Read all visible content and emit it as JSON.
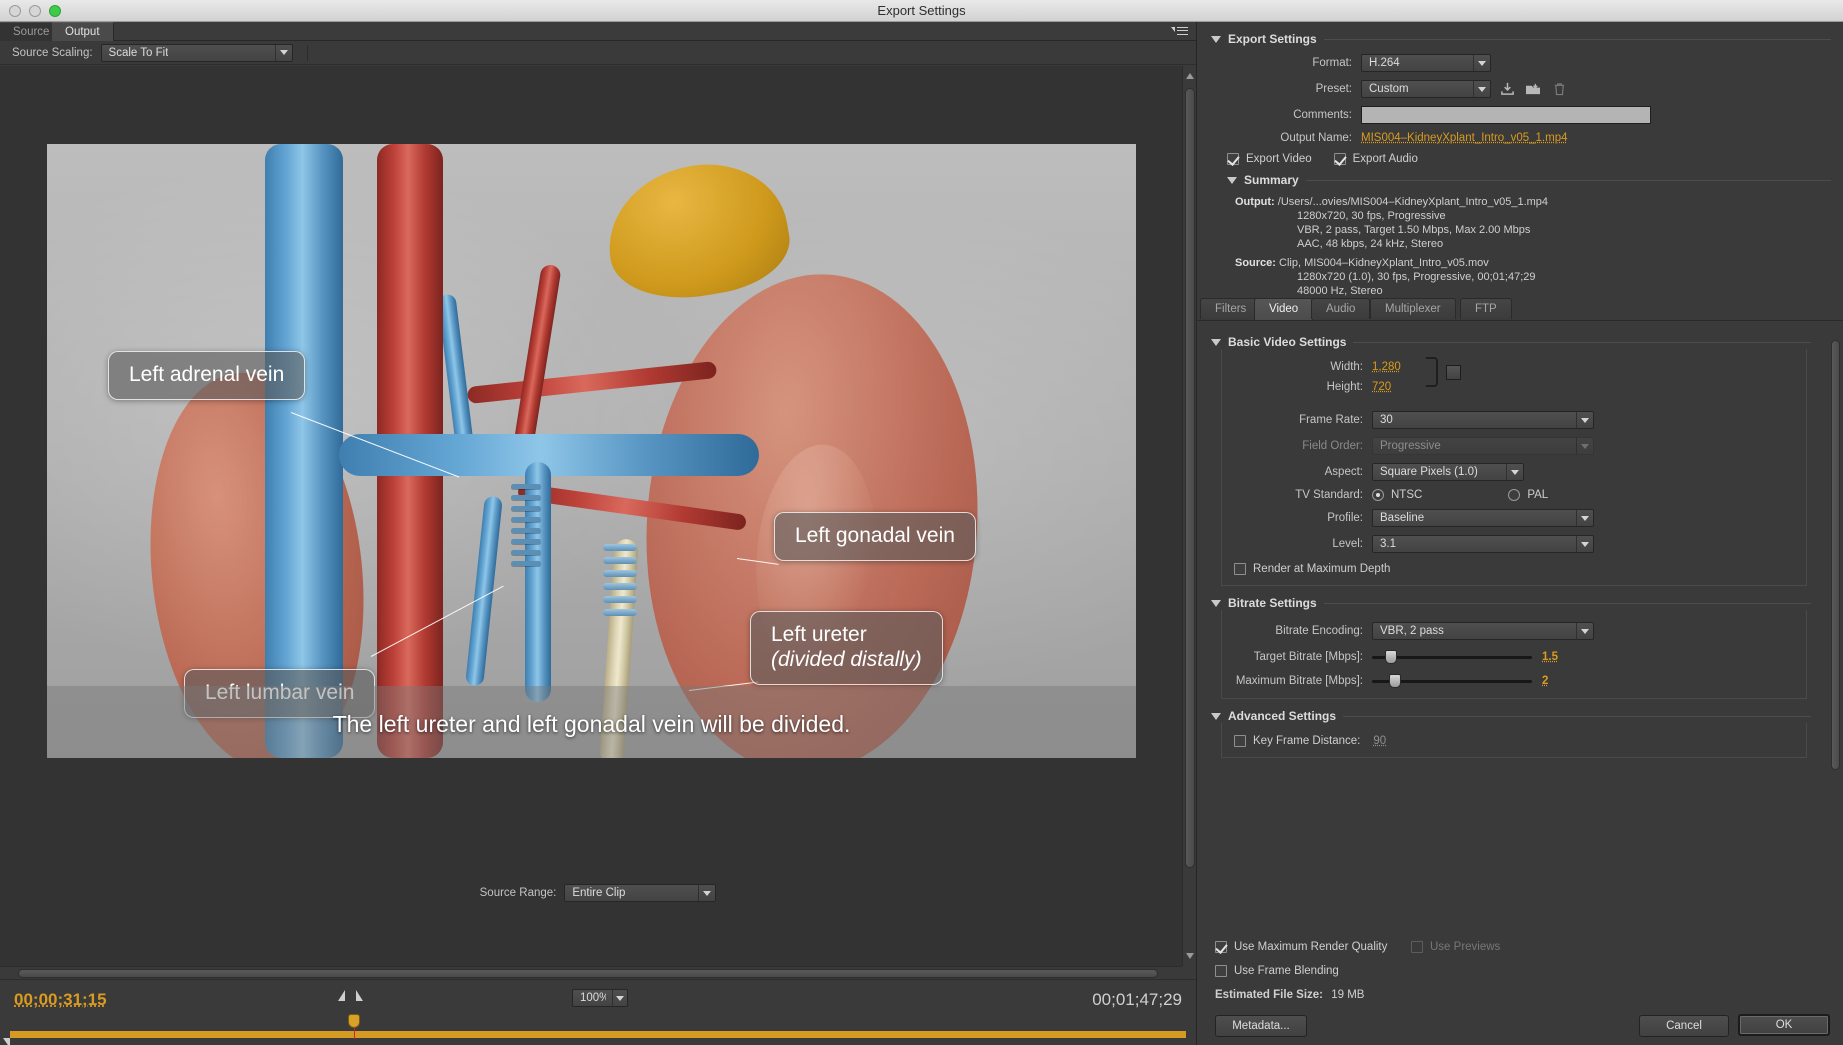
{
  "window": {
    "title": "Export Settings"
  },
  "left_panel": {
    "tabs": [
      {
        "label": "Source",
        "active": false
      },
      {
        "label": "Output",
        "active": true
      }
    ],
    "source_scaling": {
      "label": "Source Scaling:",
      "value": "Scale To Fit"
    },
    "preview": {
      "subtitle": "The left ureter and left gonadal vein will be divided.",
      "callouts": [
        {
          "text": "Left adrenal vein",
          "sub": ""
        },
        {
          "text": "Left gonadal vein",
          "sub": ""
        },
        {
          "text": "Left ureter",
          "sub": "(divided distally)"
        },
        {
          "text": "Left lumbar vein",
          "sub": ""
        }
      ]
    },
    "transport": {
      "current_timecode": "00;00;31;15",
      "duration_timecode": "00;01;47;29",
      "zoom_level": "100%",
      "source_range_label": "Source Range:",
      "source_range_value": "Entire Clip"
    }
  },
  "right_panel": {
    "export_settings": {
      "group_title": "Export Settings",
      "format_label": "Format:",
      "format_value": "H.264",
      "preset_label": "Preset:",
      "preset_value": "Custom",
      "comments_label": "Comments:",
      "comments_value": "",
      "output_name_label": "Output Name:",
      "output_name_value": "MIS004–KidneyXplant_Intro_v05_1.mp4",
      "export_video_label": "Export Video",
      "export_video_checked": true,
      "export_audio_label": "Export Audio",
      "export_audio_checked": true
    },
    "summary": {
      "group_title": "Summary",
      "output_key": "Output:",
      "output_lines": [
        "/Users/...ovies/MIS004–KidneyXplant_Intro_v05_1.mp4",
        "1280x720, 30 fps, Progressive",
        "VBR, 2 pass, Target 1.50 Mbps, Max 2.00 Mbps",
        "AAC, 48 kbps, 24 kHz, Stereo"
      ],
      "source_key": "Source:",
      "source_lines": [
        "Clip, MIS004–KidneyXplant_Intro_v05.mov",
        "1280x720 (1.0), 30 fps, Progressive, 00;01;47;29",
        "48000 Hz, Stereo"
      ]
    },
    "setting_tabs": [
      {
        "label": "Filters",
        "active": false
      },
      {
        "label": "Video",
        "active": true
      },
      {
        "label": "Audio",
        "active": false
      },
      {
        "label": "Multiplexer",
        "active": false
      },
      {
        "label": "FTP",
        "active": false
      }
    ],
    "basic_video": {
      "group_title": "Basic Video Settings",
      "width_label": "Width:",
      "width_value": "1,280",
      "height_label": "Height:",
      "height_value": "720",
      "frame_rate_label": "Frame Rate:",
      "frame_rate_value": "30",
      "field_order_label": "Field Order:",
      "field_order_value": "Progressive",
      "aspect_label": "Aspect:",
      "aspect_value": "Square Pixels (1.0)",
      "tv_standard_label": "TV Standard:",
      "tv_ntsc_label": "NTSC",
      "tv_pal_label": "PAL",
      "tv_selected": "NTSC",
      "profile_label": "Profile:",
      "profile_value": "Baseline",
      "level_label": "Level:",
      "level_value": "3.1",
      "render_max_depth_label": "Render at Maximum Depth",
      "render_max_depth_checked": false
    },
    "bitrate": {
      "group_title": "Bitrate Settings",
      "encoding_label": "Bitrate Encoding:",
      "encoding_value": "VBR, 2 pass",
      "target_label": "Target Bitrate [Mbps]:",
      "target_value": "1.5",
      "max_label": "Maximum Bitrate [Mbps]:",
      "max_value": "2"
    },
    "advanced": {
      "group_title": "Advanced Settings",
      "key_frame_label": "Key Frame Distance:",
      "key_frame_value": "90",
      "key_frame_checked": false
    },
    "footer": {
      "max_render_quality_label": "Use Maximum Render Quality",
      "max_render_quality_checked": true,
      "use_previews_label": "Use Previews",
      "use_previews_checked": false,
      "frame_blending_label": "Use Frame Blending",
      "frame_blending_checked": false,
      "estimated_size_label": "Estimated File Size:",
      "estimated_size_value": "19 MB",
      "metadata_button": "Metadata...",
      "cancel_button": "Cancel",
      "ok_button": "OK"
    }
  },
  "colors": {
    "accent_orange": "#d99b20",
    "panel_bg": "#3a3a3a",
    "text": "#cfcfcf"
  }
}
